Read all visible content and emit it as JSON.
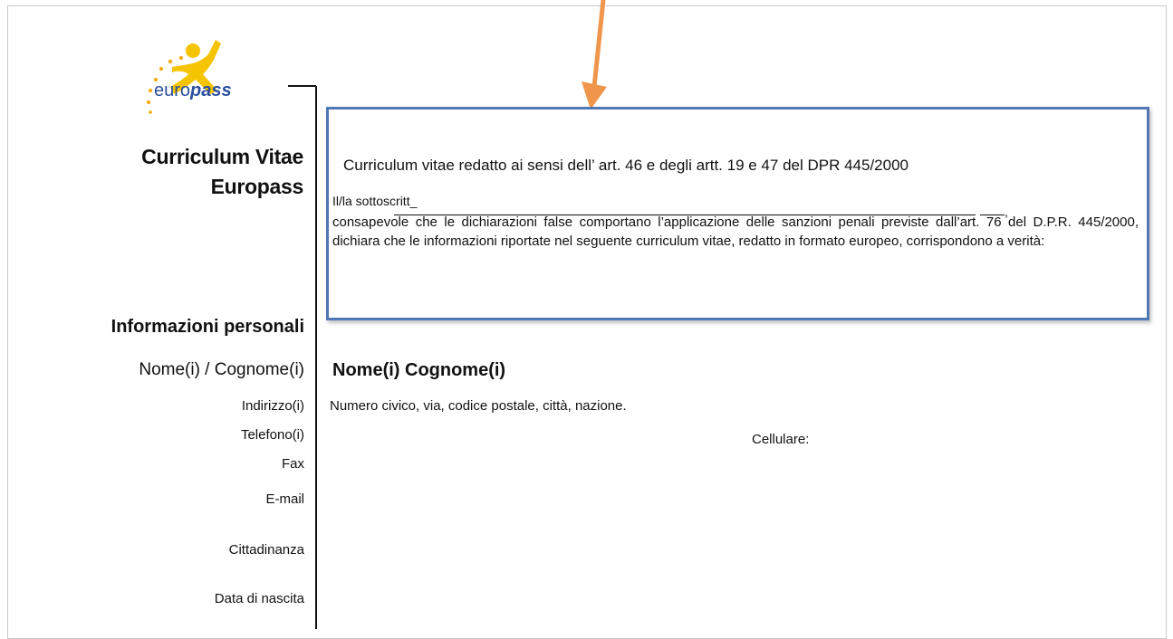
{
  "header": {
    "logo_text_plain": "euro",
    "logo_text_bold": "pass",
    "title_line1": "Curriculum Vitae",
    "title_line2": "Europass"
  },
  "declaration": {
    "heading": "Curriculum vitae redatto ai sensi dell’ art. 46 e degli artt. 19 e 47 del DPR 445/2000",
    "signer_label": "Il/la sottoscritt_",
    "signer_line_end": ",",
    "body": "consapevole che le dichiarazioni false comportano l’applicazione delle sanzioni penali previste dall’art. 76 del D.P.R. 445/2000, dichiara che le informazioni riportate nel seguente curriculum vitae, redatto in formato europeo, corrispondono a verità:",
    "border_color": "#4f78b4"
  },
  "personal": {
    "section_title": "Informazioni personali",
    "labels": {
      "name": "Nome(i) / Cognome(i)",
      "address": "Indirizzo(i)",
      "phone": "Telefono(i)",
      "fax": "Fax",
      "email": "E-mail",
      "citizenship": "Cittadinanza",
      "birthdate": "Data di nascita"
    },
    "values": {
      "name": "Nome(i) Cognome(i)",
      "address": "Numero civico, via, codice postale, città, nazione.",
      "mobile_label": "Cellulare:"
    }
  },
  "colors": {
    "arrow": "#f0964a",
    "logo_figure": "#f5c400",
    "logo_stars": "#f5a800",
    "logo_text": "#2b4f9e"
  }
}
